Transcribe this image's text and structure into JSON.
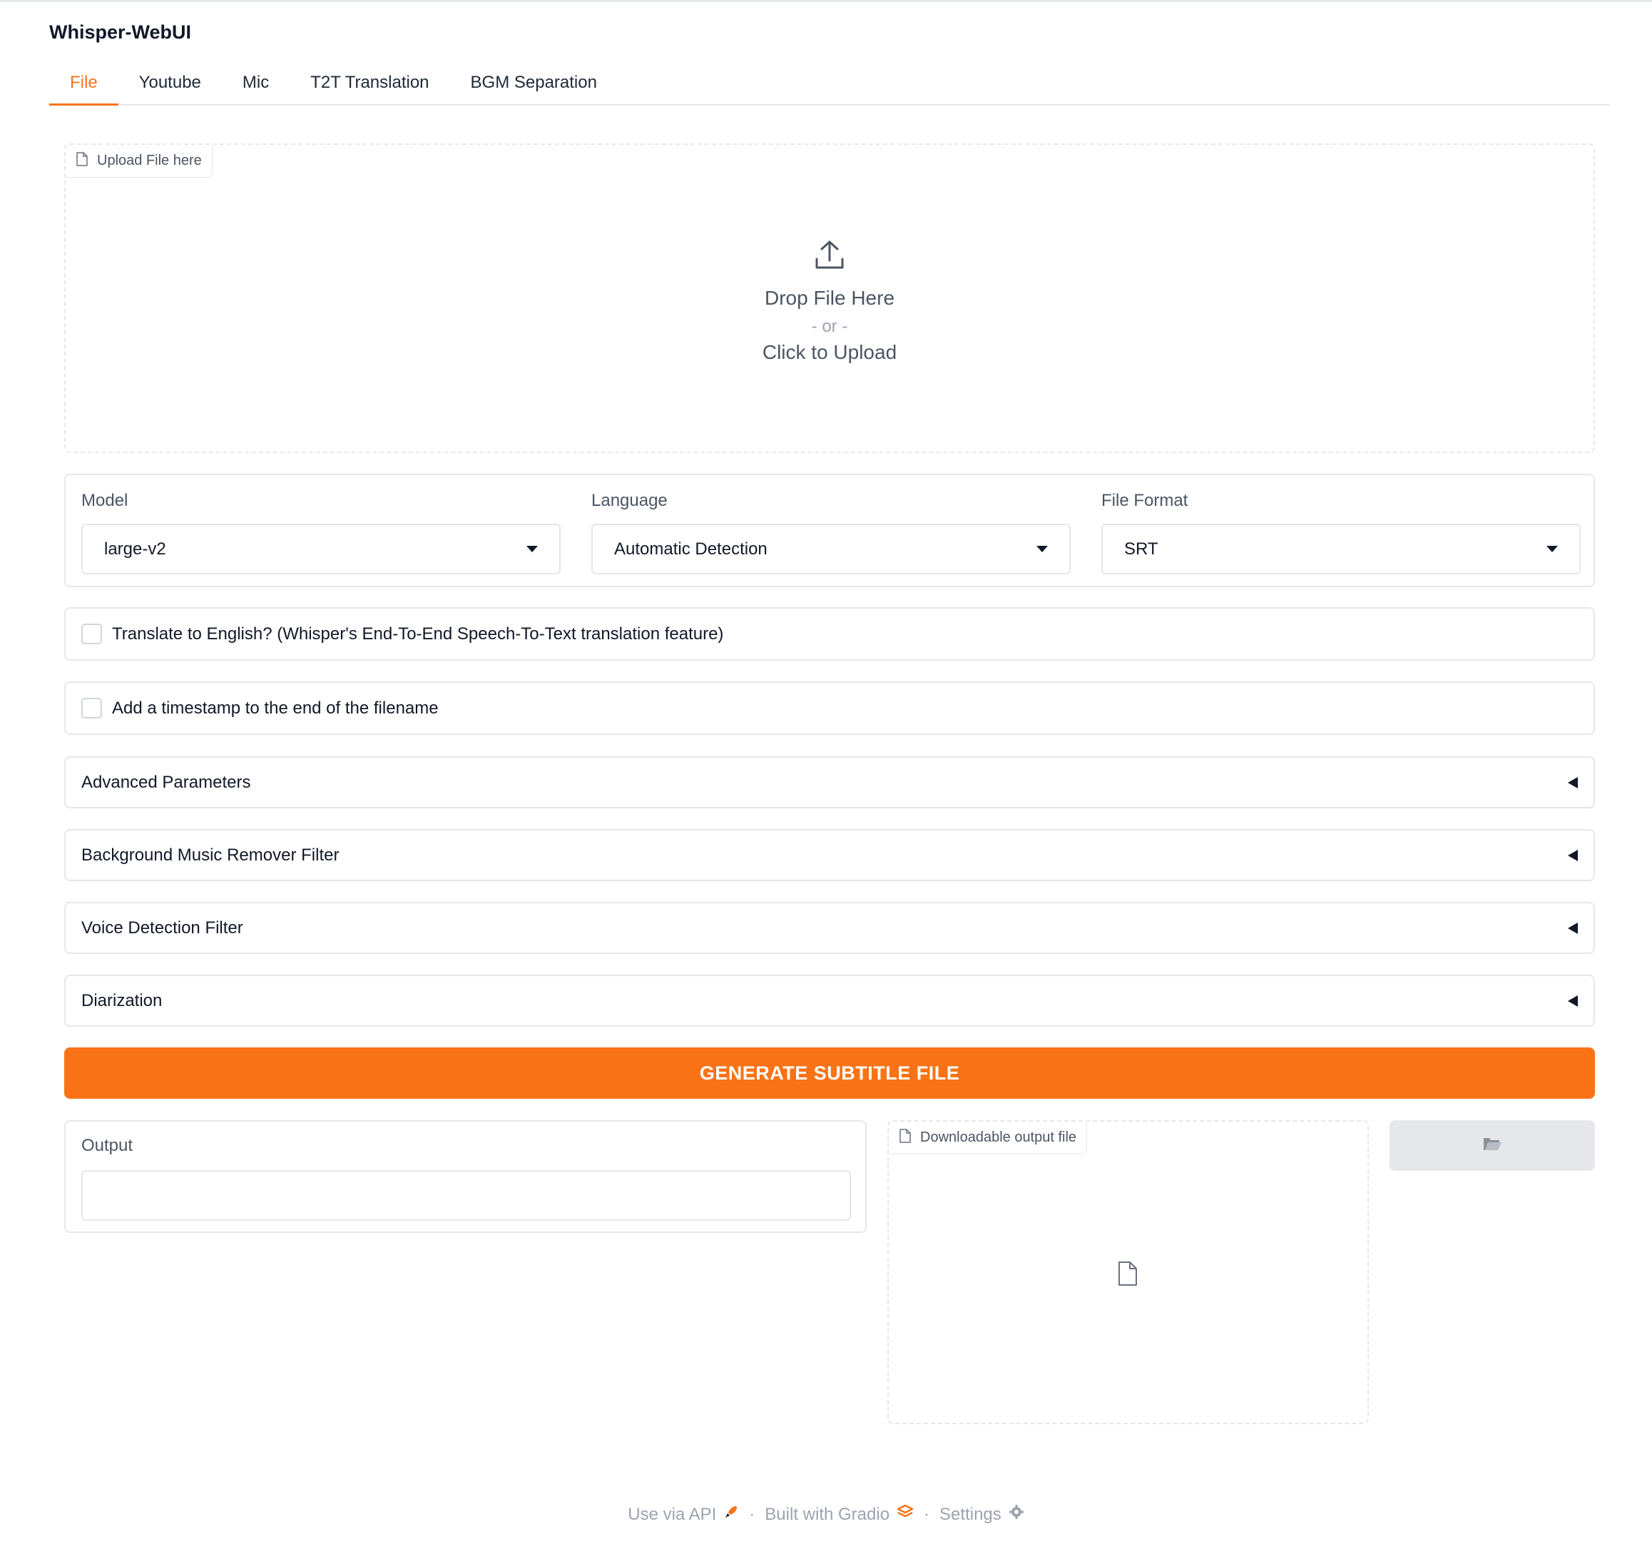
{
  "app": {
    "title": "Whisper-WebUI"
  },
  "tabs": [
    {
      "label": "File",
      "active": true
    },
    {
      "label": "Youtube",
      "active": false
    },
    {
      "label": "Mic",
      "active": false
    },
    {
      "label": "T2T Translation",
      "active": false
    },
    {
      "label": "BGM Separation",
      "active": false
    }
  ],
  "upload": {
    "label": "Upload File here",
    "drop_text": "Drop File Here",
    "or_text": "- or -",
    "click_text": "Click to Upload"
  },
  "settings": {
    "model": {
      "label": "Model",
      "value": "large-v2"
    },
    "language": {
      "label": "Language",
      "value": "Automatic Detection"
    },
    "file_format": {
      "label": "File Format",
      "value": "SRT"
    }
  },
  "options": {
    "translate_label": "Translate to English? (Whisper's End-To-End Speech-To-Text translation feature)",
    "translate_checked": false,
    "timestamp_label": "Add a timestamp to the end of the filename",
    "timestamp_checked": false
  },
  "accordions": [
    {
      "label": "Advanced Parameters"
    },
    {
      "label": "Background Music Remover Filter"
    },
    {
      "label": "Voice Detection Filter"
    },
    {
      "label": "Diarization"
    }
  ],
  "generate_button": "GENERATE SUBTITLE FILE",
  "output": {
    "label": "Output",
    "value": "",
    "download_label": "Downloadable output file"
  },
  "footer": {
    "api": "Use via API",
    "built": "Built with Gradio",
    "settings": "Settings",
    "separator": "·"
  },
  "colors": {
    "accent": "#f97316",
    "border": "#e5e7eb",
    "muted_text": "#9ca3af"
  },
  "icons": {
    "upload": "upload-icon",
    "file": "file-icon",
    "folder": "folder-icon",
    "api": "rocket-icon",
    "gradio": "gradio-logo-icon",
    "settings": "gear-icon"
  }
}
